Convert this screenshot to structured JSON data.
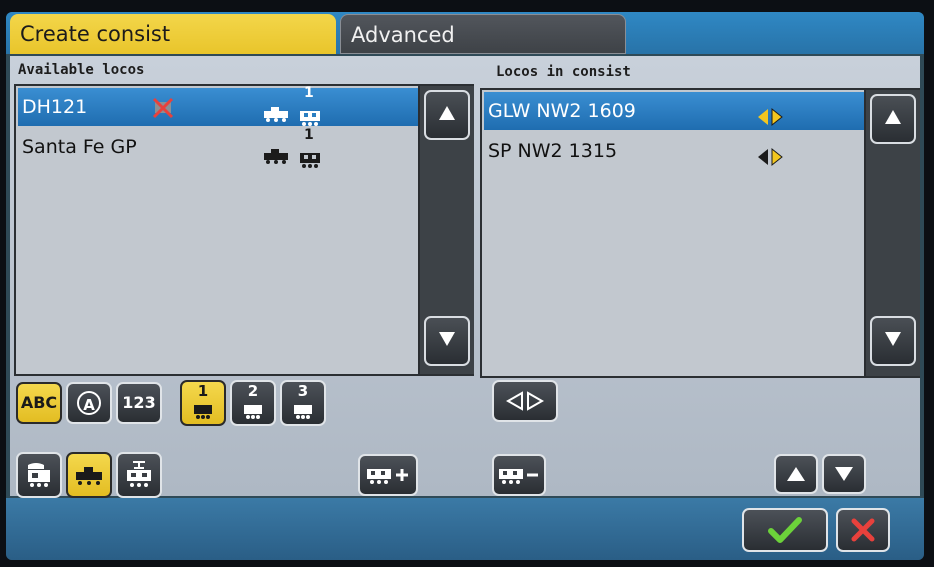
{
  "tabs": {
    "create_consist": "Create consist",
    "advanced": "Advanced"
  },
  "available": {
    "label": "Available locos",
    "items": [
      {
        "name": "DH121",
        "selected": true,
        "badge": "1",
        "status_icon": "x-cross-icon"
      },
      {
        "name": "Santa Fe GP",
        "selected": false,
        "badge": "1"
      }
    ]
  },
  "consist": {
    "label": "Locos in consist",
    "items": [
      {
        "name": "GLW NW2 1609",
        "selected": true,
        "direction_icon": "direction-toggle-icon"
      },
      {
        "name": "SP NW2 1315",
        "selected": false,
        "direction_icon": "direction-toggle-icon"
      }
    ]
  },
  "filters": {
    "abc": "ABC",
    "a": "A",
    "num": "123",
    "cab1": "1",
    "cab2": "2",
    "cab3": "3"
  },
  "icons": {
    "scroll_up": "triangle-up-icon",
    "scroll_down": "triangle-down-icon",
    "accept": "check-icon",
    "cancel": "x-icon"
  },
  "colors": {
    "accent_yellow": "#f0cf3a",
    "selection_blue": "#2a7fc2",
    "direction_yellow": "#f2c61f",
    "check_green": "#6cd23a",
    "cancel_red": "#e8413c"
  }
}
